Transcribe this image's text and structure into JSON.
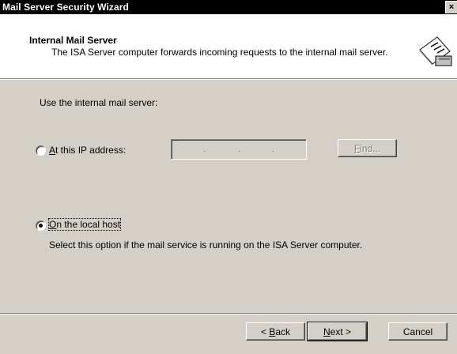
{
  "window": {
    "title": "Mail Server Security Wizard",
    "close_glyph": "×"
  },
  "header": {
    "title": "Internal Mail Server",
    "subtitle": "The ISA Server computer forwards incoming requests to the internal mail server.",
    "icon": "envelope-icon"
  },
  "body": {
    "prompt": "Use the internal mail server:",
    "option_ip": {
      "label_mnemonic": "A",
      "label_rest": "t this IP address:",
      "selected": false
    },
    "ip_field": {
      "value": "",
      "separator": "."
    },
    "find_button": {
      "mnemonic": "F",
      "rest": "ind...",
      "enabled": false
    },
    "option_local": {
      "label_mnemonic": "O",
      "label_rest": "n the local host",
      "selected": true
    },
    "local_description": "Select this option if the mail service is running on the ISA Server computer."
  },
  "footer": {
    "back_button": {
      "prefix": "< ",
      "mnemonic": "B",
      "rest": "ack"
    },
    "next_button": {
      "mnemonic": "N",
      "rest": "ext >"
    },
    "cancel_button": "Cancel"
  },
  "colors": {
    "face": "#d4d0c8",
    "titlebar": "#000000",
    "header_bg": "#ffffff"
  }
}
